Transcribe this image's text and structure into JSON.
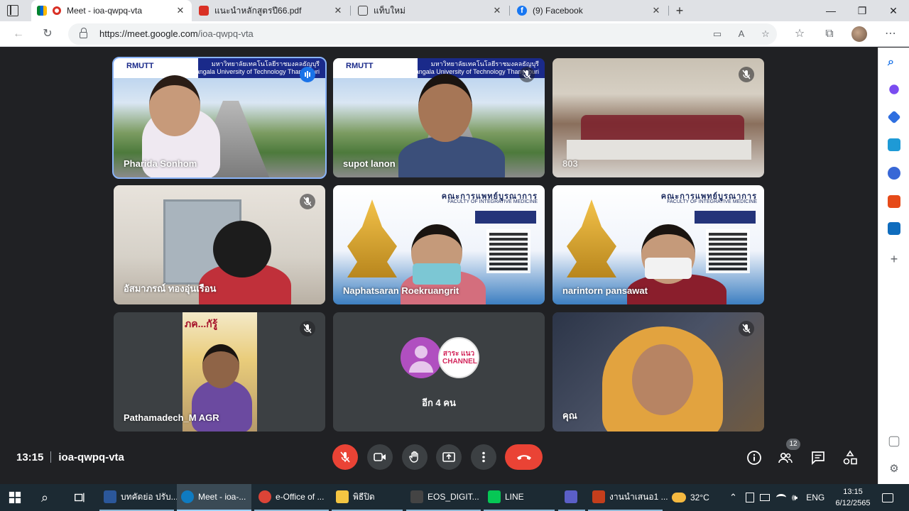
{
  "browser": {
    "tabs": [
      {
        "title": "Meet - ioa-qwpq-vta",
        "active": true,
        "icon": "google-meet-icon"
      },
      {
        "title": "แนะนำหลักสูตรปี66.pdf",
        "active": false,
        "icon": "pdf-icon"
      },
      {
        "title": "แท็บใหม่",
        "active": false,
        "icon": "newtab-icon"
      },
      {
        "title": "(9) Facebook",
        "active": false,
        "icon": "facebook-icon"
      }
    ],
    "url_host": "https://meet.google.com",
    "url_path": "/ioa-qwpq-vta"
  },
  "meet": {
    "participants": [
      {
        "name": "Pharida Sonhom",
        "muted": false,
        "speaking": true
      },
      {
        "name": "supot lanon",
        "muted": true,
        "speaking": false
      },
      {
        "name": "803",
        "muted": true,
        "speaking": false
      },
      {
        "name": "อัสมาภรณ์ ทองอุ่นเรือน",
        "muted": true,
        "speaking": false
      },
      {
        "name": "Naphatsaran Roekruangrit",
        "muted": false,
        "speaking": false
      },
      {
        "name": "narintorn pansawat",
        "muted": false,
        "speaking": false
      },
      {
        "name": "Pathamadech_M AGR",
        "muted": true,
        "speaking": false
      },
      {
        "name": "คุณ",
        "muted": true,
        "speaking": false
      }
    ],
    "others_label": "อีก 4 คน",
    "channel_text": "สาระ แนว CHANNEL",
    "rmutt_logo": "RMUTT",
    "rmutt_th": "มหาวิทยาลัยเทคโนโลยีราชมงคลธัญบุรี",
    "rmutt_en": "Rajamangala University of Technology Thanyaburi",
    "faculty_th": "คณะการแพทย์บูรณาการ",
    "faculty_en": "FACULTY OF INTEGRATIVE MEDICINE",
    "time": "13:15",
    "meeting_code": "ioa-qwpq-vta",
    "participant_count": "12"
  },
  "taskbar": {
    "items": [
      {
        "label": "บทคัดย่อ ปรับ...",
        "icon": "word-icon",
        "color": "#2b579a"
      },
      {
        "label": "Meet - ioa-...",
        "icon": "edge-icon",
        "color": "#0f7bc1"
      },
      {
        "label": "e-Office of ...",
        "icon": "chrome-icon",
        "color": "#db4437"
      },
      {
        "label": "พิธีปิด",
        "icon": "folder-icon",
        "color": "#f4c542"
      },
      {
        "label": "EOS_DIGIT...",
        "icon": "eos-icon",
        "color": "#444444"
      },
      {
        "label": "LINE",
        "icon": "line-icon",
        "color": "#06c755"
      },
      {
        "label": "",
        "icon": "teams-icon",
        "color": "#5b5fc7"
      },
      {
        "label": "งานนำเสนอ1 ...",
        "icon": "powerpoint-icon",
        "color": "#c43e1c"
      }
    ],
    "weather": "32°C",
    "lang": "ENG",
    "clock_time": "13:15",
    "clock_date": "6/12/2565"
  },
  "colors": {
    "meet_bg": "#202124",
    "tile_bg": "#3c4043",
    "speaking_outline": "#8ab4f8",
    "danger": "#ea4335"
  }
}
